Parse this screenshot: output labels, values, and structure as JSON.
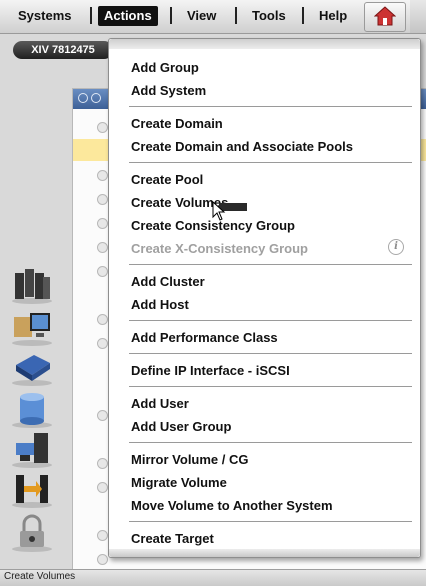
{
  "menubar": {
    "items": [
      {
        "label": "Systems"
      },
      {
        "label": "Actions"
      },
      {
        "label": "View"
      },
      {
        "label": "Tools"
      },
      {
        "label": "Help"
      }
    ],
    "home_icon": "home-icon"
  },
  "system": {
    "label": "XIV 7812475"
  },
  "dropdown": {
    "items": [
      {
        "label": "Add Group"
      },
      {
        "label": "Add System"
      },
      {
        "label": "Create Domain"
      },
      {
        "label": "Create Domain and Associate Pools"
      },
      {
        "label": "Create Pool"
      },
      {
        "label": "Create Volumes"
      },
      {
        "label": "Create Consistency Group"
      },
      {
        "label": "Create X-Consistency Group"
      },
      {
        "label": "Add Cluster"
      },
      {
        "label": "Add Host"
      },
      {
        "label": "Add Performance Class"
      },
      {
        "label": "Define IP Interface - iSCSI"
      },
      {
        "label": "Add User"
      },
      {
        "label": "Add User Group"
      },
      {
        "label": "Mirror Volume / CG"
      },
      {
        "label": "Migrate Volume"
      },
      {
        "label": "Move Volume to Another System"
      },
      {
        "label": "Create Target"
      }
    ],
    "info_glyph": "i"
  },
  "status": {
    "text": "Create Volumes"
  },
  "colors": {
    "highlight_row": "#fce89c",
    "table_header": "#4a6ea6",
    "disabled_text": "#a0a0a0"
  }
}
